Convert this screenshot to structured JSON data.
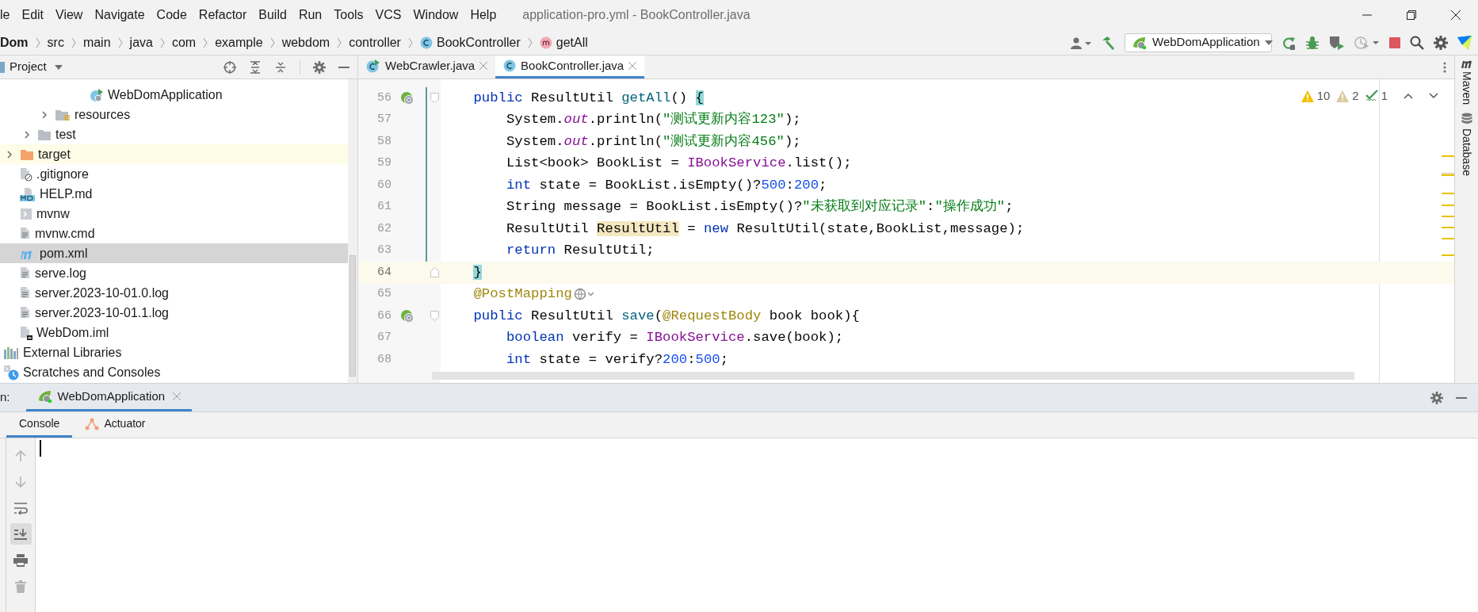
{
  "menu_bar": {
    "items": [
      "le",
      "Edit",
      "View",
      "Navigate",
      "Code",
      "Refactor",
      "Build",
      "Run",
      "Tools",
      "VCS",
      "Window",
      "Help"
    ],
    "title": "application-pro.yml - BookController.java"
  },
  "breadcrumbs": [
    {
      "label": "Dom",
      "kind": "module"
    },
    {
      "label": "src",
      "kind": "folder"
    },
    {
      "label": "main",
      "kind": "folder"
    },
    {
      "label": "java",
      "kind": "folder"
    },
    {
      "label": "com",
      "kind": "folder"
    },
    {
      "label": "example",
      "kind": "folder"
    },
    {
      "label": "webdom",
      "kind": "folder"
    },
    {
      "label": "controller",
      "kind": "folder"
    },
    {
      "label": "BookController",
      "kind": "class"
    },
    {
      "label": "getAll",
      "kind": "method"
    }
  ],
  "run_configuration": "WebDomApplication",
  "project_panel": {
    "title": "Project",
    "tree": [
      {
        "children": [
          {
            "children": [
              {
                "children": [
                  {
                    "children": [
                      {
                        "children": [
                          {
                            "label": "WebDomApplication",
                            "kind": "spring-class",
                            "selected": false,
                            "highlighted": false
                          }
                        ]
                      }
                    ]
                  },
                  {
                    "label": "resources",
                    "kind": "resources-folder",
                    "expanded": false,
                    "selected": false,
                    "highlighted": false
                  }
                ]
              },
              {
                "label": "test",
                "kind": "folder",
                "expanded": false,
                "selected": false,
                "highlighted": false
              }
            ]
          },
          {
            "label": "target",
            "kind": "excluded-folder",
            "expanded": false,
            "selected": false,
            "highlighted": true
          },
          {
            "label": ".gitignore",
            "kind": "ignore-file",
            "selected": false,
            "highlighted": false
          },
          {
            "label": "HELP.md",
            "kind": "markdown-file",
            "selected": false,
            "highlighted": false
          },
          {
            "label": "mvnw",
            "kind": "script-file",
            "selected": false,
            "highlighted": false
          },
          {
            "label": "mvnw.cmd",
            "kind": "text-file",
            "selected": false,
            "highlighted": false
          },
          {
            "label": "pom.xml",
            "kind": "maven-file",
            "selected": true,
            "highlighted": false
          },
          {
            "label": "serve.log",
            "kind": "text-file",
            "selected": false,
            "highlighted": false
          },
          {
            "label": "server.2023-10-01.0.log",
            "kind": "text-file",
            "selected": false,
            "highlighted": false
          },
          {
            "label": "server.2023-10-01.1.log",
            "kind": "text-file",
            "selected": false,
            "highlighted": false
          },
          {
            "label": "WebDom.iml",
            "kind": "iml-file",
            "selected": false,
            "highlighted": false
          }
        ]
      },
      {
        "label": "External Libraries",
        "kind": "libraries",
        "selected": false,
        "highlighted": false
      },
      {
        "label": "Scratches and Consoles",
        "kind": "scratches",
        "selected": false,
        "highlighted": false
      }
    ]
  },
  "editor_tabs": [
    {
      "label": "WebCrawler.java",
      "kind": "runnable-class",
      "selected": false
    },
    {
      "label": "BookController.java",
      "kind": "class",
      "selected": true
    }
  ],
  "inspections": {
    "warnings": "10",
    "weak_warnings": "2",
    "typos": "1"
  },
  "code_lines": [
    {
      "number": "56",
      "run_icon": true,
      "fold_start": true,
      "fold_end": false,
      "current": false,
      "tokens": [
        {
          "kind": "kw",
          "text": "    public"
        },
        {
          "kind": "plain",
          "text": " ResultUtil "
        },
        {
          "kind": "method",
          "text": "getAll"
        },
        {
          "kind": "plain",
          "text": "() "
        },
        {
          "kind": "brace",
          "text": "{"
        }
      ]
    },
    {
      "number": "57",
      "run_icon": false,
      "fold_start": false,
      "fold_end": false,
      "current": false,
      "tokens": [
        {
          "kind": "plain",
          "text": "        System."
        },
        {
          "kind": "field",
          "text": "out"
        },
        {
          "kind": "plain",
          "text": ".println("
        },
        {
          "kind": "str",
          "text": "\"测试更新内容123\""
        },
        {
          "kind": "plain",
          "text": ");"
        }
      ]
    },
    {
      "number": "58",
      "run_icon": false,
      "fold_start": false,
      "fold_end": false,
      "current": false,
      "tokens": [
        {
          "kind": "plain",
          "text": "        System."
        },
        {
          "kind": "field",
          "text": "out"
        },
        {
          "kind": "plain",
          "text": ".println("
        },
        {
          "kind": "str",
          "text": "\"测试更新内容456\""
        },
        {
          "kind": "plain",
          "text": ");"
        }
      ]
    },
    {
      "number": "59",
      "run_icon": false,
      "fold_start": false,
      "fold_end": false,
      "current": false,
      "tokens": [
        {
          "kind": "plain",
          "text": "        List<book> BookList = "
        },
        {
          "kind": "static",
          "text": "IBookService"
        },
        {
          "kind": "plain",
          "text": ".list();"
        }
      ]
    },
    {
      "number": "60",
      "run_icon": false,
      "fold_start": false,
      "fold_end": false,
      "current": false,
      "tokens": [
        {
          "kind": "kw",
          "text": "        int"
        },
        {
          "kind": "plain",
          "text": " state = BookList.isEmpty()?"
        },
        {
          "kind": "num",
          "text": "500"
        },
        {
          "kind": "plain",
          "text": ":"
        },
        {
          "kind": "num",
          "text": "200"
        },
        {
          "kind": "plain",
          "text": ";"
        }
      ]
    },
    {
      "number": "61",
      "run_icon": false,
      "fold_start": false,
      "fold_end": false,
      "current": false,
      "tokens": [
        {
          "kind": "plain",
          "text": "        String message = BookList.isEmpty()?"
        },
        {
          "kind": "str",
          "text": "\"未获取到对应记录\""
        },
        {
          "kind": "plain",
          "text": ":"
        },
        {
          "kind": "str",
          "text": "\"操作成功\""
        },
        {
          "kind": "plain",
          "text": ";"
        }
      ]
    },
    {
      "number": "62",
      "run_icon": false,
      "fold_start": false,
      "fold_end": false,
      "current": false,
      "tokens": [
        {
          "kind": "plain",
          "text": "        ResultUtil "
        },
        {
          "kind": "usage",
          "text": "ResultUtil"
        },
        {
          "kind": "plain",
          "text": " = "
        },
        {
          "kind": "kw",
          "text": "new"
        },
        {
          "kind": "plain",
          "text": " ResultUtil(state,BookList,message);"
        }
      ]
    },
    {
      "number": "63",
      "run_icon": false,
      "fold_start": false,
      "fold_end": false,
      "current": false,
      "tokens": [
        {
          "kind": "kw",
          "text": "        return"
        },
        {
          "kind": "plain",
          "text": " ResultUtil;"
        }
      ]
    },
    {
      "number": "64",
      "run_icon": false,
      "fold_start": false,
      "fold_end": true,
      "current": true,
      "tokens": [
        {
          "kind": "brace",
          "text": "    }"
        }
      ]
    },
    {
      "number": "65",
      "run_icon": false,
      "fold_start": false,
      "fold_end": false,
      "endpoint_hint": true,
      "current": false,
      "tokens": [
        {
          "kind": "ann",
          "text": "    @PostMapping"
        }
      ]
    },
    {
      "number": "66",
      "run_icon": true,
      "fold_start": true,
      "fold_end": false,
      "current": false,
      "tokens": [
        {
          "kind": "kw",
          "text": "    public"
        },
        {
          "kind": "plain",
          "text": " ResultUtil "
        },
        {
          "kind": "method",
          "text": "save"
        },
        {
          "kind": "plain",
          "text": "("
        },
        {
          "kind": "ann",
          "text": "@RequestBody"
        },
        {
          "kind": "plain",
          "text": " book book){"
        }
      ]
    },
    {
      "number": "67",
      "run_icon": false,
      "fold_start": false,
      "fold_end": false,
      "current": false,
      "tokens": [
        {
          "kind": "kw",
          "text": "        boolean"
        },
        {
          "kind": "plain",
          "text": " verify = "
        },
        {
          "kind": "static",
          "text": "IBookService"
        },
        {
          "kind": "plain",
          "text": ".save(book);"
        }
      ]
    },
    {
      "number": "68",
      "run_icon": false,
      "fold_start": false,
      "fold_end": false,
      "current": false,
      "tokens": [
        {
          "kind": "kw",
          "text": "        int"
        },
        {
          "kind": "plain",
          "text": " state = verify?"
        },
        {
          "kind": "num",
          "text": "200"
        },
        {
          "kind": "plain",
          "text": ":"
        },
        {
          "kind": "num",
          "text": "500"
        },
        {
          "kind": "plain",
          "text": ";"
        }
      ]
    }
  ],
  "side_tools": [
    "Maven",
    "Database"
  ],
  "run_window": {
    "label": "n:",
    "tab": "WebDomApplication",
    "tabs": [
      {
        "label": "Console",
        "kind": "console",
        "selected": true
      },
      {
        "label": "Actuator",
        "kind": "actuator",
        "selected": false
      }
    ],
    "tools": [
      {
        "kind": "up",
        "disabled": true,
        "on": false
      },
      {
        "kind": "down",
        "disabled": true,
        "on": false
      },
      {
        "kind": "wrap",
        "disabled": false,
        "on": false
      },
      {
        "kind": "scroll-end",
        "disabled": false,
        "on": true
      },
      {
        "kind": "print",
        "disabled": false,
        "on": false
      },
      {
        "kind": "clear",
        "disabled": true,
        "on": false
      }
    ]
  }
}
